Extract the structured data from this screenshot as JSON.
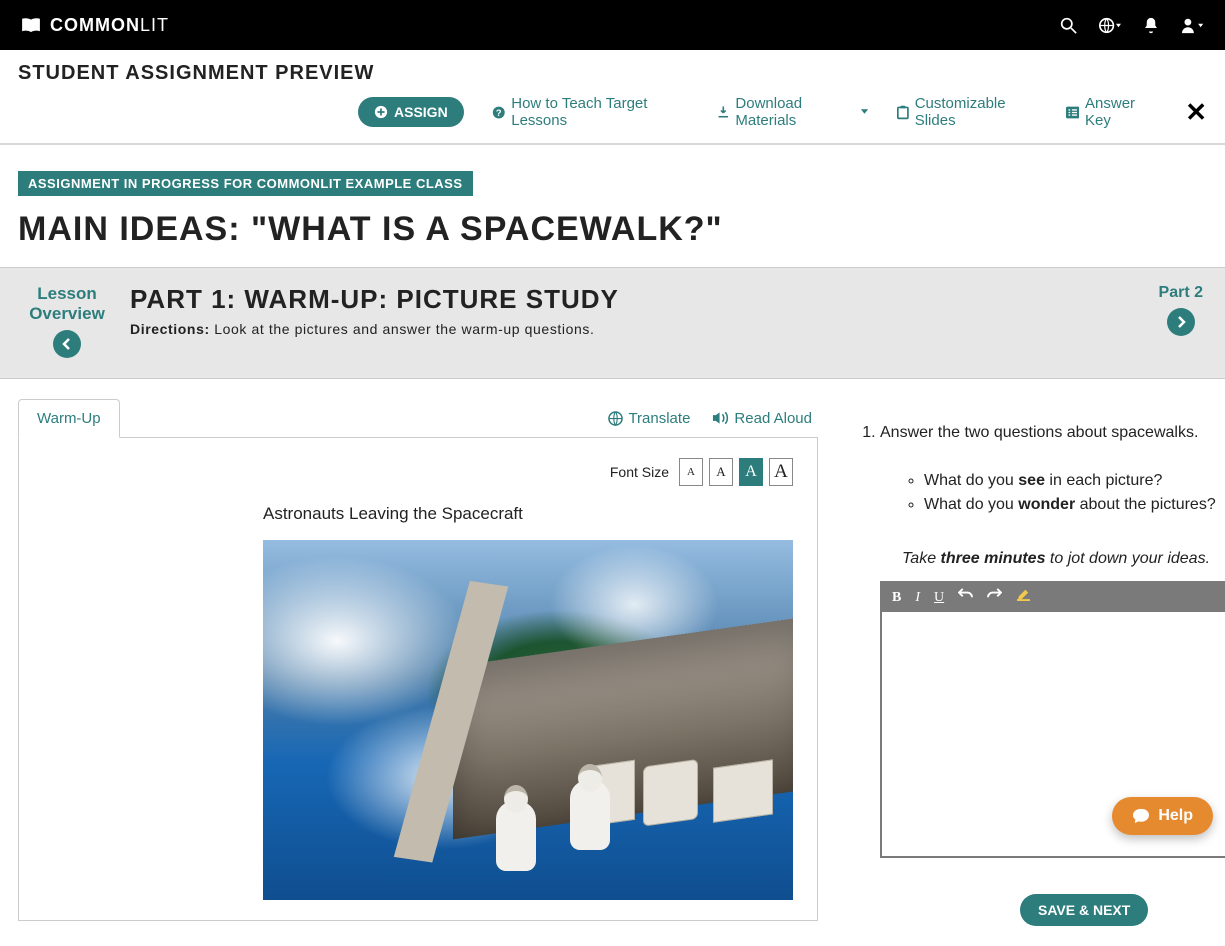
{
  "brand": {
    "name_bold": "COMMON",
    "name_light": "LIT"
  },
  "preview_title": "STUDENT ASSIGNMENT PREVIEW",
  "toolbar": {
    "assign": "ASSIGN",
    "how_to": "How to Teach Target Lessons",
    "download": "Download Materials",
    "slides": "Customizable Slides",
    "answer_key": "Answer Key"
  },
  "progress_badge": "ASSIGNMENT IN PROGRESS FOR COMMONLIT EXAMPLE CLASS",
  "main_title": "MAIN IDEAS: \"WHAT IS A SPACEWALK?\"",
  "nav": {
    "overview_line1": "Lesson",
    "overview_line2": "Overview",
    "part_title": "PART 1: WARM-UP: PICTURE STUDY",
    "directions_label": "Directions:",
    "directions_text": " Look at the pictures and answer the warm-up questions.",
    "next_label": "Part 2"
  },
  "tabs": {
    "warmup": "Warm-Up",
    "translate": "Translate",
    "read_aloud": "Read Aloud"
  },
  "font": {
    "label": "Font Size",
    "glyph": "A"
  },
  "image_caption": "Astronauts Leaving the Spacecraft",
  "question": {
    "number": "1.",
    "prompt": "Answer the two questions about spacewalks.",
    "bullet1_pre": "What do you ",
    "bullet1_bold": "see",
    "bullet1_post": " in each picture?",
    "bullet2_pre": "What do you ",
    "bullet2_bold": "wonder",
    "bullet2_post": " about the pictures?",
    "hint_pre": "Take ",
    "hint_bold": "three minutes",
    "hint_post": " to jot down your ideas."
  },
  "editor": {
    "bold": "B",
    "italic": "I",
    "underline": "U"
  },
  "buttons": {
    "save_next": "SAVE & NEXT",
    "help": "Help"
  }
}
